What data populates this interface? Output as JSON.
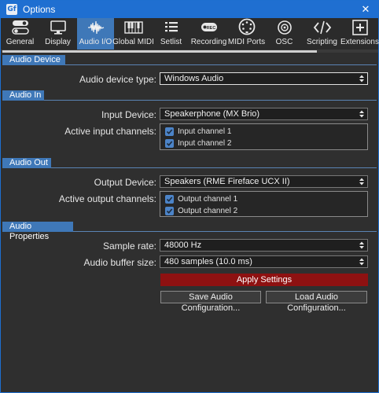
{
  "window": {
    "title": "Options",
    "app_icon_text": "Gf",
    "close_glyph": "✕"
  },
  "toolbar": {
    "tabs": [
      {
        "label": "General",
        "icon": "toggle-switches-icon",
        "active": false
      },
      {
        "label": "Display",
        "icon": "monitor-icon",
        "active": false
      },
      {
        "label": "Audio I/O",
        "icon": "waveform-icon",
        "active": true
      },
      {
        "label": "Global MIDI",
        "icon": "piano-keys-icon",
        "active": false
      },
      {
        "label": "Setlist",
        "icon": "list-icon",
        "active": false
      },
      {
        "label": "Recording",
        "icon": "rec-icon",
        "active": false
      },
      {
        "label": "MIDI Ports",
        "icon": "midi-connector-icon",
        "active": false
      },
      {
        "label": "OSC",
        "icon": "osc-icon",
        "active": false
      },
      {
        "label": "Scripting",
        "icon": "code-brackets-icon",
        "active": false
      },
      {
        "label": "Extensions",
        "icon": "plus-box-icon",
        "active": false
      }
    ],
    "rec_badge": "REC"
  },
  "audio_device": {
    "section_title": "Audio Device",
    "type_label": "Audio device type:",
    "type_value": "Windows Audio"
  },
  "audio_in": {
    "section_title": "Audio In",
    "device_label": "Input Device:",
    "device_value": "Speakerphone (MX Brio)",
    "channels_label": "Active input channels:",
    "channels": [
      {
        "label": "Input channel 1",
        "checked": true
      },
      {
        "label": "Input channel 2",
        "checked": true
      }
    ]
  },
  "audio_out": {
    "section_title": "Audio Out",
    "device_label": "Output Device:",
    "device_value": "Speakers (RME Fireface UCX II)",
    "channels_label": "Active output channels:",
    "channels": [
      {
        "label": "Output channel 1",
        "checked": true
      },
      {
        "label": "Output channel 2",
        "checked": true
      }
    ]
  },
  "audio_properties": {
    "section_title": "Audio Properties",
    "sample_rate_label": "Sample rate:",
    "sample_rate_value": "48000 Hz",
    "buffer_label": "Audio buffer size:",
    "buffer_value": "480 samples (10.0 ms)",
    "apply_label": "Apply Settings",
    "save_label": "Save Audio Configuration...",
    "load_label": "Load Audio Configuration..."
  },
  "colors": {
    "titlebar": "#1f6fd1",
    "accent": "#3f78b8",
    "background": "#2f2f2f",
    "apply_button": "#8e1111",
    "checkbox": "#4c84c8"
  }
}
